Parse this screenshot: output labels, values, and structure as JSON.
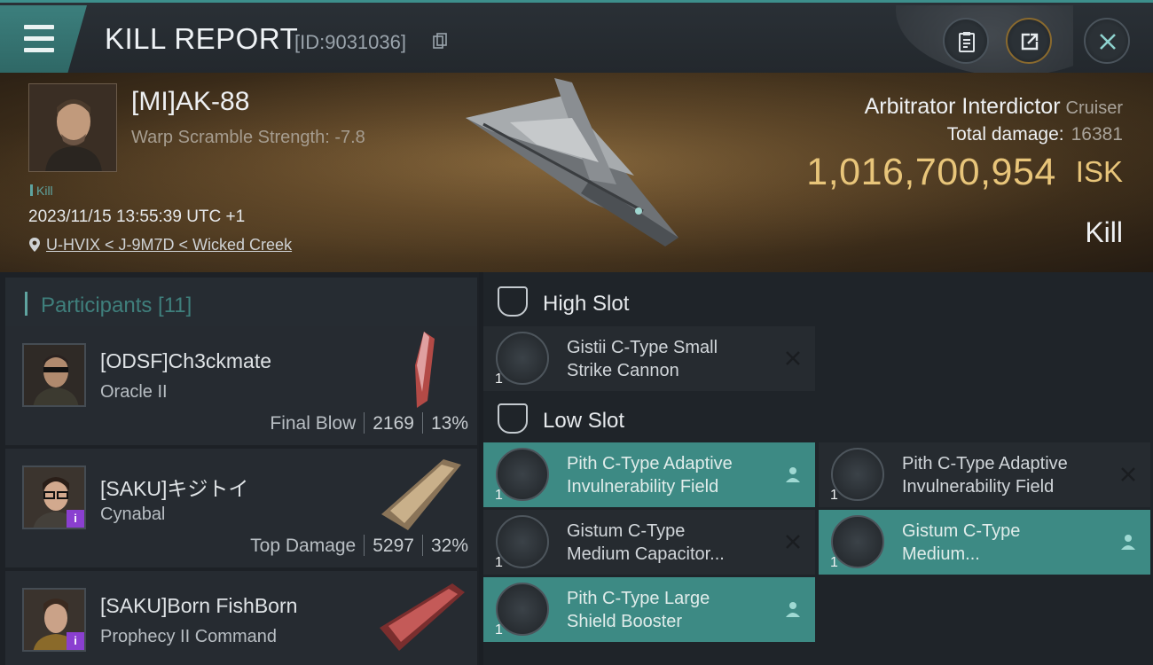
{
  "header": {
    "title": "KILL REPORT",
    "kill_id": "[ID:9031036]"
  },
  "victim": {
    "name": "[MI]AK-88",
    "warp_scramble": "Warp Scramble Strength: -7.8",
    "tag": "Kill",
    "datetime": "2023/11/15 13:55:39 UTC +1",
    "location": "U-HVIX < J-9M7D < Wicked Creek",
    "ship_name": "Arbitrator Interdictor",
    "ship_class": "Cruiser",
    "damage_label": "Total damage:",
    "damage_value": "16381",
    "isk_amount": "1,016,700,954",
    "isk_currency": "ISK",
    "result": "Kill"
  },
  "participants": {
    "label": "Participants [11]",
    "rows": [
      {
        "name": "[ODSF]Ch3ckmate",
        "ship": "Oracle II",
        "role": "Final Blow",
        "damage": "2169",
        "percent": "13%"
      },
      {
        "name": "[SAKU]キジトイ",
        "ship": "Cynabal",
        "role": "Top Damage",
        "damage": "5297",
        "percent": "32%",
        "badge": "i"
      },
      {
        "name": "[SAKU]Born FishBorn",
        "ship": "Prophecy II Command",
        "badge": "i"
      }
    ]
  },
  "fitting": {
    "high_slot": {
      "label": "High Slot",
      "modules": [
        {
          "line1": "Gistii C-Type Small",
          "line2": "Strike Cannon",
          "qty": "1",
          "status": "destroyed"
        }
      ]
    },
    "low_slot": {
      "label": "Low Slot",
      "modules": [
        {
          "line1": "Pith C-Type Adaptive",
          "line2": "Invulnerability Field",
          "qty": "1",
          "status": "dropped"
        },
        {
          "line1": "Pith C-Type Adaptive",
          "line2": "Invulnerability Field",
          "qty": "1",
          "status": "destroyed"
        },
        {
          "line1": "Gistum C-Type",
          "line2": "Medium Capacitor...",
          "qty": "1",
          "status": "destroyed"
        },
        {
          "line1": "Gistum C-Type",
          "line2": "Medium...",
          "qty": "1",
          "status": "dropped"
        },
        {
          "line1": "Pith C-Type Large",
          "line2": "Shield Booster",
          "qty": "1",
          "status": "dropped"
        }
      ]
    }
  },
  "colors": {
    "accent_teal": "#3d8a84",
    "isk_gold": "#e8c57a",
    "badge_purple": "#8a3fd0"
  },
  "icons": [
    "menu-icon",
    "clipboard-icon",
    "share-icon",
    "close-icon",
    "copy-icon",
    "location-pin-icon",
    "slot-icon",
    "destroyed-x-icon",
    "dropped-person-icon"
  ]
}
